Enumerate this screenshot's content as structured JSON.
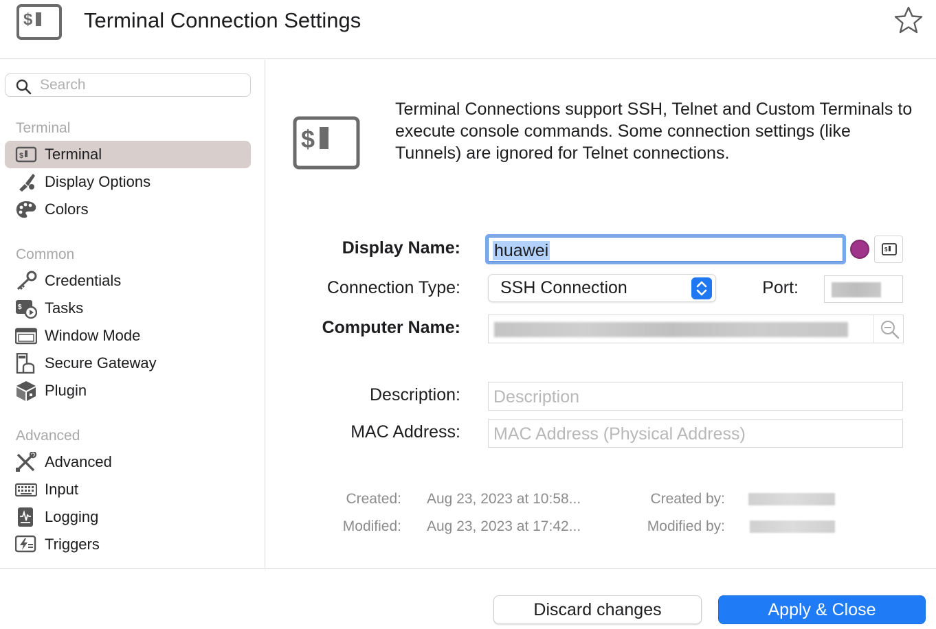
{
  "header": {
    "title": "Terminal Connection Settings",
    "icon": "terminal-icon",
    "favorite_icon": "star-icon"
  },
  "sidebar": {
    "search_placeholder": "Search",
    "sections": [
      {
        "label": "Terminal",
        "items": [
          {
            "label": "Terminal",
            "icon": "terminal-icon",
            "selected": true
          },
          {
            "label": "Display Options",
            "icon": "brush-icon"
          },
          {
            "label": "Colors",
            "icon": "palette-icon"
          }
        ]
      },
      {
        "label": "Common",
        "items": [
          {
            "label": "Credentials",
            "icon": "key-icon"
          },
          {
            "label": "Tasks",
            "icon": "tasks-icon"
          },
          {
            "label": "Window Mode",
            "icon": "window-icon"
          },
          {
            "label": "Secure Gateway",
            "icon": "gateway-icon"
          },
          {
            "label": "Plugin",
            "icon": "plugin-icon"
          }
        ]
      },
      {
        "label": "Advanced",
        "items": [
          {
            "label": "Advanced",
            "icon": "tools-icon"
          },
          {
            "label": "Input",
            "icon": "keyboard-icon"
          },
          {
            "label": "Logging",
            "icon": "log-icon"
          },
          {
            "label": "Triggers",
            "icon": "trigger-icon"
          }
        ]
      }
    ]
  },
  "main": {
    "intro": "Terminal Connections support SSH, Telnet and Custom Terminals to execute console commands. Some connection settings (like Tunnels) are ignored for Telnet connections.",
    "display_name_label": "Display Name:",
    "display_name_value": "huawei",
    "color_accent": "#a0338a",
    "connection_type_label": "Connection Type:",
    "connection_type_value": "SSH Connection",
    "port_label": "Port:",
    "computer_name_label": "Computer Name:",
    "description_label": "Description:",
    "description_placeholder": "Description",
    "mac_label": "MAC Address:",
    "mac_placeholder": "MAC Address (Physical Address)",
    "created_label": "Created:",
    "created_value": "Aug 23, 2023 at 10:58...",
    "modified_label": "Modified:",
    "modified_value": "Aug 23, 2023 at 17:42...",
    "created_by_label": "Created by:",
    "modified_by_label": "Modified by:"
  },
  "footer": {
    "discard_label": "Discard changes",
    "apply_label": "Apply & Close",
    "primary_color": "#1f7cf6"
  }
}
